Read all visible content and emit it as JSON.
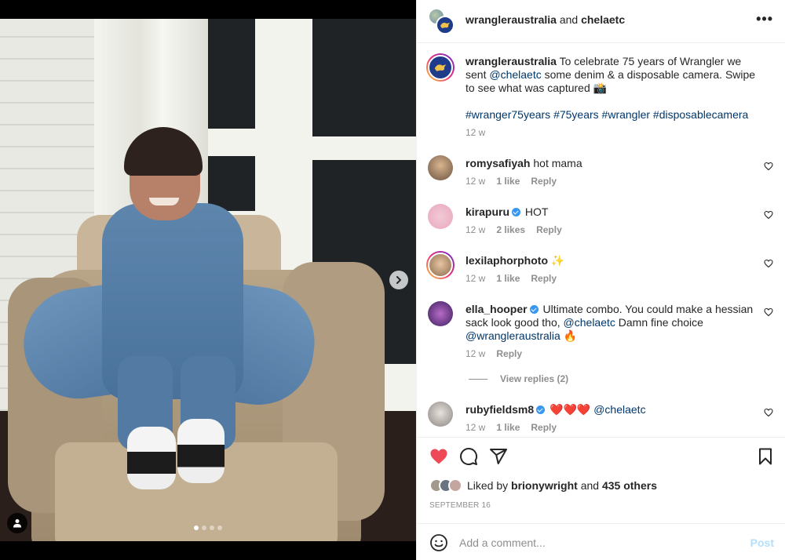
{
  "header": {
    "account1": "wrangleraustralia",
    "connector": " and ",
    "account2": "chelaetc",
    "more_icon": "more-horizontal-icon",
    "more_label": "•••"
  },
  "caption": {
    "username": "wrangleraustralia",
    "text_part1": " To celebrate 75 years of Wrangler we sent ",
    "mention": "@chelaetc",
    "text_part2": " some denim & a disposable camera. Swipe to see what was captured 📸",
    "hashtags": [
      "#wranger75years",
      "#75years",
      "#wrangler",
      "#disposablecamera"
    ],
    "time": "12 w"
  },
  "comments": [
    {
      "username": "romysafiyah",
      "verified": false,
      "text": " hot mama",
      "time": "12 w",
      "likes": "1 like",
      "reply": "Reply"
    },
    {
      "username": "kirapuru",
      "verified": true,
      "text": " HOT",
      "time": "12 w",
      "likes": "2 likes",
      "reply": "Reply"
    },
    {
      "username": "lexilaphorphoto",
      "verified": false,
      "text": " ✨",
      "time": "12 w",
      "likes": "1 like",
      "reply": "Reply"
    },
    {
      "username": "ella_hooper",
      "verified": true,
      "text_part1": " Ultimate combo. You could make a hessian sack look good tho, ",
      "mention1": "@chelaetc",
      "text_part2": " Damn fine choice ",
      "mention2": "@wrangleraustralia",
      "text_part3": " 🔥",
      "time": "12 w",
      "reply": "Reply"
    },
    {
      "username": "rubyfieldsm8",
      "verified": true,
      "text": " ❤️❤️❤️ ",
      "mention": "@chelaetc",
      "time": "12 w",
      "likes": "1 like",
      "reply": "Reply"
    }
  ],
  "view_replies": "View replies (2)",
  "actions": {
    "like_icon": "heart-filled-icon",
    "comment_icon": "comment-bubble-icon",
    "share_icon": "paper-plane-icon",
    "save_icon": "bookmark-icon"
  },
  "likes": {
    "prefix": "Liked by ",
    "user": "brionywright",
    "middle": " and ",
    "others": "435 others"
  },
  "date": "SEPTEMBER 16",
  "comment_box": {
    "placeholder": "Add a comment...",
    "post_label": "Post",
    "emoji_icon": "smiley-icon"
  },
  "carousel": {
    "count": 4,
    "active_index": 0
  },
  "colors": {
    "like_red": "#ed4956",
    "link_blue": "#00376b",
    "verified_blue": "#3897f0",
    "post_disabled": "#b2dffc",
    "muted": "#8e8e8e"
  }
}
